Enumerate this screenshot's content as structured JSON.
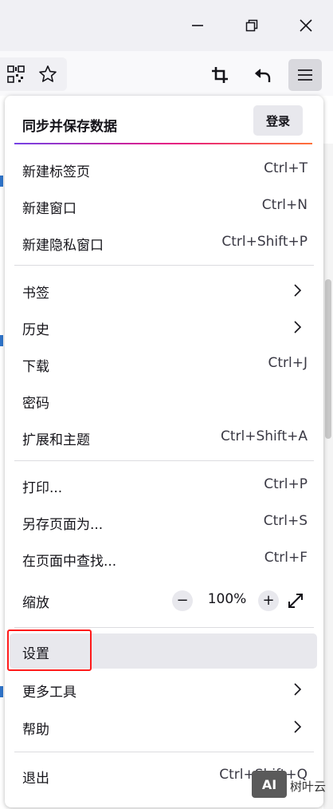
{
  "window": {
    "minimize_icon": "minimize-icon",
    "restore_icon": "restore-icon",
    "close_icon": "close-icon"
  },
  "toolbar": {
    "qr_icon": "qr-code-icon",
    "star_icon": "bookmark-star-icon",
    "crop_icon": "screenshot-crop-icon",
    "back_icon": "undo-arrow-icon",
    "menu_icon": "hamburger-menu-icon"
  },
  "menu": {
    "sync_title": "同步并保存数据",
    "login_label": "登录",
    "items": [
      {
        "label": "新建标签页",
        "shortcut": "Ctrl+T"
      },
      {
        "label": "新建窗口",
        "shortcut": "Ctrl+N"
      },
      {
        "label": "新建隐私窗口",
        "shortcut": "Ctrl+Shift+P"
      },
      {
        "label": "书签",
        "shortcut": ""
      },
      {
        "label": "历史",
        "shortcut": ""
      },
      {
        "label": "下载",
        "shortcut": "Ctrl+J"
      },
      {
        "label": "密码",
        "shortcut": ""
      },
      {
        "label": "扩展和主题",
        "shortcut": "Ctrl+Shift+A"
      },
      {
        "label": "打印...",
        "shortcut": "Ctrl+P"
      },
      {
        "label": "另存页面为...",
        "shortcut": "Ctrl+S"
      },
      {
        "label": "在页面中查找...",
        "shortcut": "Ctrl+F"
      },
      {
        "label": "缩放",
        "shortcut": ""
      },
      {
        "label": "设置",
        "shortcut": ""
      },
      {
        "label": "更多工具",
        "shortcut": ""
      },
      {
        "label": "帮助",
        "shortcut": ""
      },
      {
        "label": "退出",
        "shortcut": "Ctrl+Shift+Q"
      }
    ],
    "zoom": {
      "minus": "−",
      "value": "100%",
      "plus": "+"
    }
  },
  "watermark": {
    "logo_text": "AI",
    "text": "树叶云"
  },
  "colors": {
    "highlight": "#ff1a1a",
    "gradient_start": "#7542e5",
    "gradient_mid": "#e31587",
    "gradient_end": "#ff7139"
  }
}
